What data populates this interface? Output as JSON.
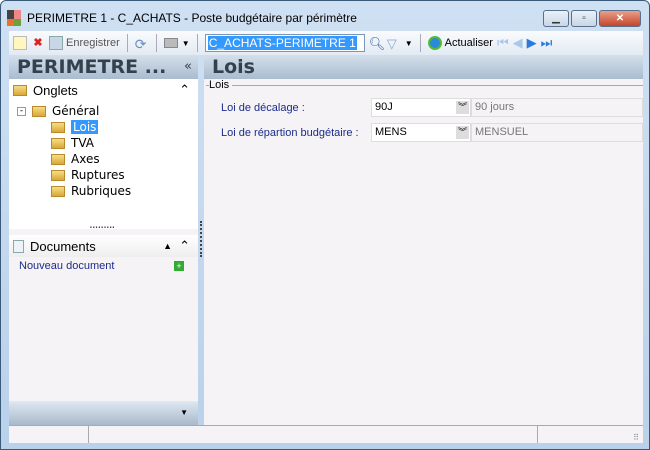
{
  "window": {
    "title": "PERIMETRE 1 - C_ACHATS -  Poste budgétaire par périmètre"
  },
  "toolbar": {
    "save_label": "Enregistrer",
    "search_value": "C_ACHATS-PERIMETRE 1",
    "refresh_label": "Actualiser"
  },
  "left": {
    "header": "PERIMETRE ...",
    "collapse": "«",
    "onglets_title": "Onglets",
    "tree_root": "Général",
    "tree_items": [
      "Lois",
      "TVA",
      "Axes",
      "Ruptures",
      "Rubriques"
    ],
    "documents_title": "Documents",
    "new_document": "Nouveau document"
  },
  "main": {
    "title": "Lois",
    "group": "Lois",
    "fields": [
      {
        "label": "Loi de décalage :",
        "value": "90J",
        "description": "90 jours"
      },
      {
        "label": "Loi de répartion budgétaire :",
        "value": "MENS",
        "description": "MENSUEL"
      }
    ]
  },
  "colors": {
    "selection": "#3399ff",
    "label": "#1a2c8a"
  }
}
